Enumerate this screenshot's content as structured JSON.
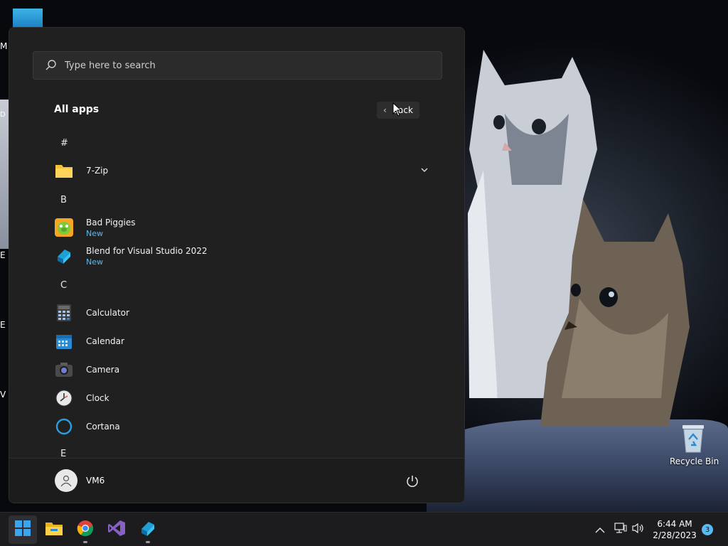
{
  "desktop": {
    "partial_labels": [
      "M",
      "D",
      "E",
      "E",
      "V"
    ],
    "recycle_bin_label": "Recycle Bin"
  },
  "start_menu": {
    "search_placeholder": "Type here to search",
    "section_title": "All apps",
    "back_label": "Back",
    "groups": [
      {
        "letter": "#",
        "apps": [
          {
            "name": "7-Zip",
            "sub": "",
            "icon": "folder-icon",
            "expandable": true
          }
        ]
      },
      {
        "letter": "B",
        "apps": [
          {
            "name": "Bad Piggies",
            "sub": "New",
            "icon": "bad-piggies-icon"
          },
          {
            "name": "Blend for Visual Studio 2022",
            "sub": "New",
            "icon": "blend-icon"
          }
        ]
      },
      {
        "letter": "C",
        "apps": [
          {
            "name": "Calculator",
            "sub": "",
            "icon": "calculator-icon"
          },
          {
            "name": "Calendar",
            "sub": "",
            "icon": "calendar-icon"
          },
          {
            "name": "Camera",
            "sub": "",
            "icon": "camera-icon"
          },
          {
            "name": "Clock",
            "sub": "",
            "icon": "clock-icon"
          },
          {
            "name": "Cortana",
            "sub": "",
            "icon": "cortana-icon"
          }
        ]
      },
      {
        "letter": "E",
        "apps": []
      }
    ],
    "user_name": "VM6"
  },
  "taskbar": {
    "apps": [
      "start-icon",
      "file-explorer-icon",
      "chrome-icon",
      "visual-studio-icon",
      "blend-icon"
    ],
    "time": "6:44 AM",
    "date": "2/28/2023",
    "notification_count": "3"
  },
  "colors": {
    "menu_bg": "#202020",
    "accent": "#5ab9f0",
    "taskbar_bg": "#1c1c1f"
  }
}
